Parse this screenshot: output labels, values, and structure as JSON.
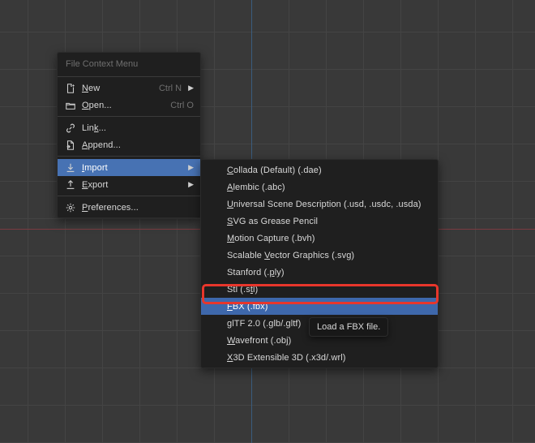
{
  "menu_title": "File Context Menu",
  "menu1": {
    "new": {
      "label_pre": "",
      "label_u": "N",
      "label_post": "ew",
      "shortcut": "Ctrl N",
      "has_arrow": true
    },
    "open": {
      "label_pre": "",
      "label_u": "O",
      "label_post": "pen...",
      "shortcut": "Ctrl O",
      "has_arrow": false
    },
    "link": {
      "label_pre": "Lin",
      "label_u": "k",
      "label_post": "...",
      "shortcut": "",
      "has_arrow": false
    },
    "append": {
      "label_pre": "",
      "label_u": "A",
      "label_post": "ppend...",
      "shortcut": "",
      "has_arrow": false
    },
    "import": {
      "label_pre": "",
      "label_u": "I",
      "label_post": "mport",
      "shortcut": "",
      "has_arrow": true
    },
    "export": {
      "label_pre": "",
      "label_u": "E",
      "label_post": "xport",
      "shortcut": "",
      "has_arrow": true
    },
    "prefs": {
      "label_pre": "",
      "label_u": "P",
      "label_post": "references...",
      "shortcut": "",
      "has_arrow": false
    }
  },
  "menu2": {
    "items": [
      {
        "pre": "",
        "u": "C",
        "post": "ollada (Default) (.dae)",
        "selected": false
      },
      {
        "pre": "",
        "u": "A",
        "post": "lembic (.abc)",
        "selected": false
      },
      {
        "pre": "",
        "u": "U",
        "post": "niversal Scene Description (.usd, .usdc, .usda)",
        "selected": false
      },
      {
        "pre": "",
        "u": "S",
        "post": "VG as Grease Pencil",
        "selected": false
      },
      {
        "pre": "",
        "u": "M",
        "post": "otion Capture (.bvh)",
        "selected": false
      },
      {
        "pre": "Scalable ",
        "u": "V",
        "post": "ector Graphics (.svg)",
        "selected": false
      },
      {
        "pre": "Stanford (.",
        "u": "p",
        "post": "ly)",
        "selected": false
      },
      {
        "pre": "Stl (.s",
        "u": "t",
        "post": "l)",
        "selected": false
      },
      {
        "pre": "",
        "u": "F",
        "post": "BX (.fbx)",
        "selected": true
      },
      {
        "pre": "",
        "u": "g",
        "post": "lTF 2.0 (.glb/.gltf)",
        "selected": false
      },
      {
        "pre": "",
        "u": "W",
        "post": "avefront (.obj)",
        "selected": false
      },
      {
        "pre": "",
        "u": "X",
        "post": "3D Extensible 3D (.x3d/.wrl)",
        "selected": false
      }
    ]
  },
  "tooltip": "Load a FBX file."
}
